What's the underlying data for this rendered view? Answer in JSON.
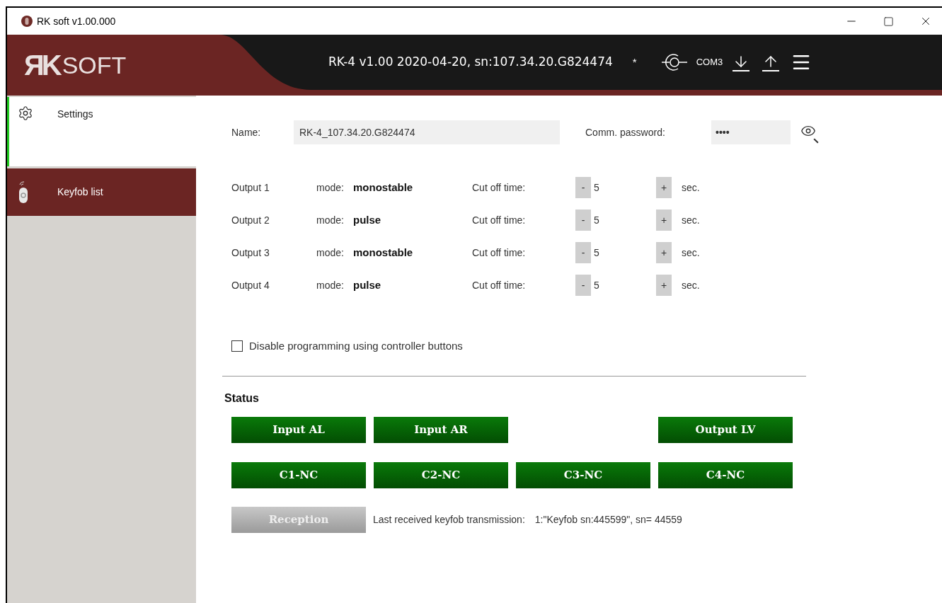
{
  "window": {
    "title": "RK soft v1.00.000"
  },
  "header": {
    "logo_bold": "ЯK",
    "logo_light": "SOFT",
    "device": "RK-4 v1.00 2020-04-20,  sn:107.34.20.G824474",
    "modified_mark": "*",
    "port": "COM3"
  },
  "sidebar": {
    "items": [
      {
        "label": "Settings",
        "kind": "settings",
        "selected": true
      },
      {
        "label": "Keyfob list",
        "kind": "keyfobs",
        "selected": false
      }
    ]
  },
  "settings": {
    "name_label": "Name:",
    "name_value": "RK-4_107.34.20.G824474",
    "password_label": "Comm. password:",
    "password_value": "••••",
    "outputs": [
      {
        "label": "Output 1",
        "mode_label": "mode:",
        "mode": "monostable",
        "cut_off_label": "Cut off time:",
        "minus": "-",
        "value": "5",
        "plus": "+",
        "unit": "sec."
      },
      {
        "label": "Output 2",
        "mode_label": "mode:",
        "mode": "pulse",
        "cut_off_label": "Cut off time:",
        "minus": "-",
        "value": "5",
        "plus": "+",
        "unit": "sec."
      },
      {
        "label": "Output 3",
        "mode_label": "mode:",
        "mode": "monostable",
        "cut_off_label": "Cut off time:",
        "minus": "-",
        "value": "5",
        "plus": "+",
        "unit": "sec."
      },
      {
        "label": "Output 4",
        "mode_label": "mode:",
        "mode": "pulse",
        "cut_off_label": "Cut off time:",
        "minus": "-",
        "value": "5",
        "plus": "+",
        "unit": "sec."
      }
    ],
    "disable_programming": {
      "label": "Disable programming using controller buttons",
      "checked": false
    }
  },
  "status": {
    "title": "Status",
    "inputs": [
      {
        "label": "Input AL",
        "kind": "input",
        "on": true
      },
      {
        "label": "Input AR",
        "kind": "input",
        "on": true
      },
      {
        "label": "Output LV",
        "kind": "output",
        "on": true
      }
    ],
    "contacts": [
      {
        "label": "C1-NC",
        "on": true
      },
      {
        "label": "C2-NC",
        "on": true
      },
      {
        "label": "C3-NC",
        "on": true
      },
      {
        "label": "C4-NC",
        "on": true
      }
    ],
    "reception": {
      "label": "Reception",
      "on": false
    },
    "last_label": "Last received keyfob transmission:",
    "last_value": "1:\"Keyfob sn:445599\", sn= 44559"
  }
}
